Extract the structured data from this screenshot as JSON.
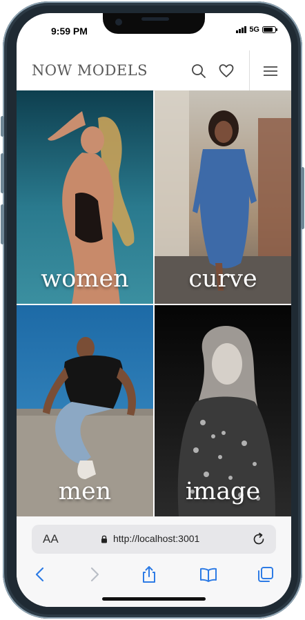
{
  "status_bar": {
    "time": "9:59 PM",
    "network": "5G",
    "battery_level": 0.85
  },
  "header": {
    "logo": "NOW MODELS"
  },
  "categories": [
    {
      "label": "women",
      "bg": "#1e5a6b"
    },
    {
      "label": "curve",
      "bg": "#a98e73"
    },
    {
      "label": "men",
      "bg": "#2a73a8"
    },
    {
      "label": "image",
      "bg": "#141414"
    }
  ],
  "browser": {
    "text_size_label": "AA",
    "url": "http://localhost:3001"
  },
  "icons": [
    "search-icon",
    "heart-icon",
    "menu-icon",
    "lock-icon",
    "reload-icon",
    "back-icon",
    "forward-icon",
    "share-icon",
    "bookmarks-icon",
    "tabs-icon"
  ]
}
